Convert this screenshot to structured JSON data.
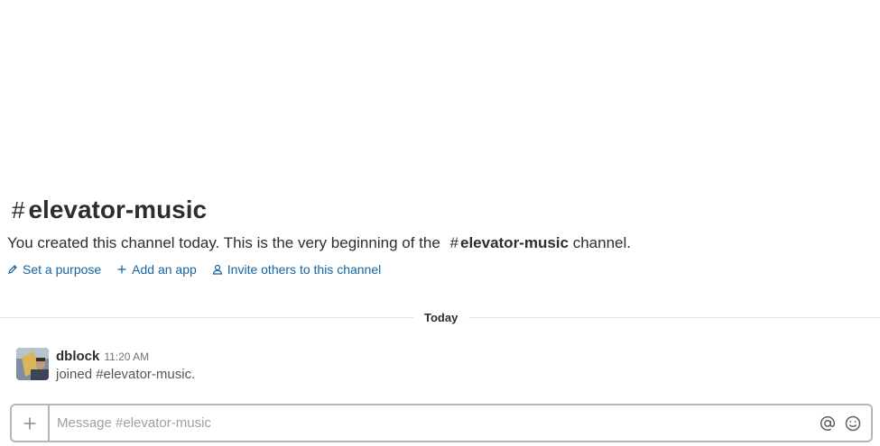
{
  "channel": {
    "hash": "#",
    "name": "elevator-music"
  },
  "intro": {
    "text_before": "You created this channel today. This is the very beginning of the",
    "channel_hash": "#",
    "channel_name": "elevator-music",
    "text_after": "channel.",
    "actions": [
      {
        "label": "Set a purpose",
        "icon": "pencil-icon"
      },
      {
        "label": "Add an app",
        "icon": "plus-icon"
      },
      {
        "label": "Invite others to this channel",
        "icon": "person-icon"
      }
    ]
  },
  "divider": {
    "label": "Today"
  },
  "messages": [
    {
      "sender": "dblock",
      "time": "11:20 AM",
      "text": "joined #elevator-music."
    }
  ],
  "composer": {
    "placeholder": "Message #elevator-music",
    "value": "",
    "icons": [
      "plus-icon",
      "at-sign-icon",
      "emoji-icon"
    ]
  },
  "colors": {
    "link": "#1264a3",
    "text": "#2c2d30",
    "border": "#b6b6b8"
  }
}
